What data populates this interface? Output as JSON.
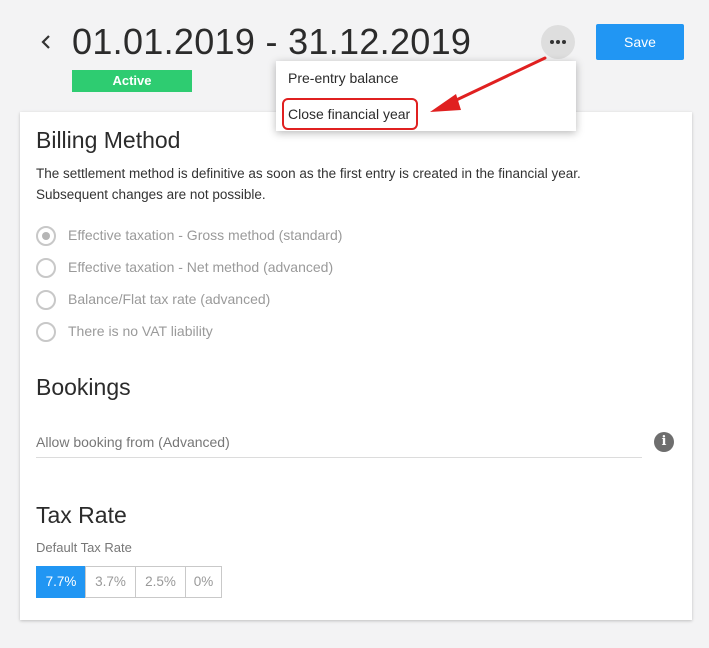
{
  "header": {
    "title": "01.01.2019 - 31.12.2019",
    "status_badge": "Active",
    "save_label": "Save"
  },
  "dropdown_menu": {
    "items": [
      {
        "label": "Pre-entry balance"
      },
      {
        "label": "Close financial year"
      }
    ]
  },
  "billing_method": {
    "title": "Billing Method",
    "description": "The settlement method is definitive as soon as the first entry is created in the financial year. Subsequent changes are not possible.",
    "options": [
      {
        "label": "Effective taxation - Gross method (standard)",
        "selected": true
      },
      {
        "label": "Effective taxation - Net method (advanced)",
        "selected": false
      },
      {
        "label": "Balance/Flat tax rate (advanced)",
        "selected": false
      },
      {
        "label": "There is no VAT liability",
        "selected": false
      }
    ]
  },
  "bookings": {
    "title": "Bookings",
    "field_label": "Allow booking from (Advanced)",
    "info_icon": "info-icon"
  },
  "tax_rate": {
    "title": "Tax Rate",
    "field_label": "Default Tax Rate",
    "options": [
      "7.7%",
      "3.7%",
      "2.5%",
      "0%"
    ],
    "selected": "7.7%"
  },
  "colors": {
    "accent": "#2196f3",
    "status_active": "#2ecc71",
    "annotation": "#e02020"
  }
}
